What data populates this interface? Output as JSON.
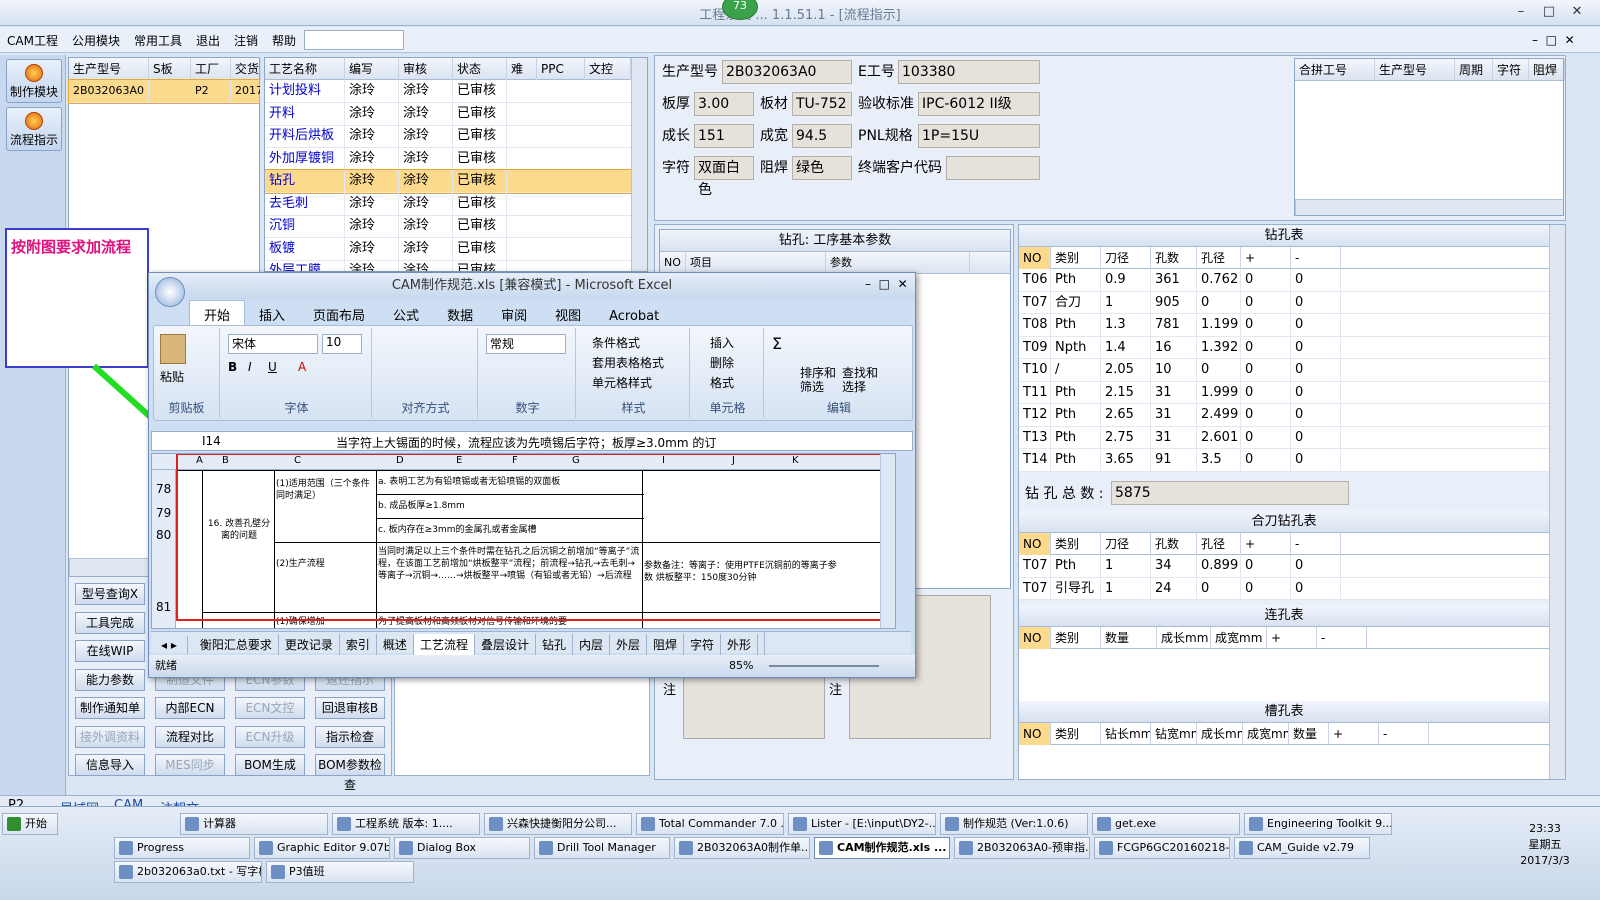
{
  "app": {
    "title": "工程系统 ...  1.1.51.1 - [流程指示]",
    "badge": "73",
    "min": "–",
    "max": "□",
    "close": "✕"
  },
  "menu": {
    "items": [
      "CAM工程",
      "公用模块",
      "常用工具",
      "退出",
      "注销",
      "帮助"
    ],
    "helpArrow": "▾",
    "innerCtrl": [
      "–",
      "□",
      "✕"
    ]
  },
  "leftbar": {
    "btn1": "制作模块",
    "btn2": "流程指示"
  },
  "orderGrid": {
    "headers": [
      "生产型号",
      "S板",
      "工厂",
      "交货"
    ],
    "row": [
      "2B032063A0",
      "",
      "P2",
      "2017"
    ]
  },
  "processGrid": {
    "headers": [
      "工艺名称",
      "编写",
      "审核",
      "状态",
      "难",
      "PPC",
      "文控"
    ],
    "rows": [
      [
        "计划投料",
        "涂玲",
        "涂玲",
        "已审核"
      ],
      [
        "开料",
        "涂玲",
        "涂玲",
        "已审核"
      ],
      [
        "开料后烘板",
        "涂玲",
        "涂玲",
        "已审核"
      ],
      [
        "外加厚镀铜",
        "涂玲",
        "涂玲",
        "已审核"
      ],
      [
        "钻孔",
        "涂玲",
        "涂玲",
        "已审核"
      ],
      [
        "去毛刺",
        "涂玲",
        "涂玲",
        "已审核"
      ],
      [
        "沉铜",
        "涂玲",
        "涂玲",
        "已审核"
      ],
      [
        "板镀",
        "涂玲",
        "涂玲",
        "已审核"
      ],
      [
        "外层工膜",
        "涂玲",
        "涂玲",
        "已审核"
      ]
    ]
  },
  "note": {
    "text": "按附图要求加流程"
  },
  "info": {
    "l_model": "生产型号",
    "model": "2B032063A0",
    "l_eno": "E工号",
    "eno": "103380",
    "l_thick": "板厚",
    "thick": "3.00",
    "l_mat": "板材",
    "mat": "TU-752",
    "l_std": "验收标准",
    "std": "IPC-6012 II级",
    "l_len": "成长",
    "len": "151",
    "l_wid": "成宽",
    "wid": "94.5",
    "l_pnl": "PNL规格",
    "pnl": "1P=15U",
    "l_char": "字符",
    "char": "双面白色",
    "l_mask": "阻焊",
    "mask": "绿色",
    "l_cust": "终端客户代码",
    "cust": ""
  },
  "mergeGrid": {
    "headers": [
      "合拼工号",
      "生产型号",
      "周期",
      "字符",
      "阻焊"
    ]
  },
  "drillParam": {
    "title": "钻孔: 工序基本参数",
    "headers": [
      "NO",
      "项目",
      "参数"
    ]
  },
  "drillTable": {
    "title": "钻孔表",
    "headers": [
      "NO",
      "类别",
      "刀径",
      "孔数",
      "孔径",
      "+",
      "-"
    ],
    "rows": [
      [
        "T06",
        "Pth",
        "0.9",
        "361",
        "0.762",
        "0",
        "0"
      ],
      [
        "T07",
        "合刀",
        "1",
        "905",
        "0",
        "0",
        "0"
      ],
      [
        "T08",
        "Pth",
        "1.3",
        "781",
        "1.199",
        "0",
        "0"
      ],
      [
        "T09",
        "Npth",
        "1.4",
        "16",
        "1.392",
        "0",
        "0"
      ],
      [
        "T10",
        "/",
        "2.05",
        "10",
        "0",
        "0",
        "0"
      ],
      [
        "T11",
        "Pth",
        "2.15",
        "31",
        "1.999",
        "0",
        "0"
      ],
      [
        "T12",
        "Pth",
        "2.65",
        "31",
        "2.499",
        "0",
        "0"
      ],
      [
        "T13",
        "Pth",
        "2.75",
        "31",
        "2.601",
        "0",
        "0"
      ],
      [
        "T14",
        "Pth",
        "3.65",
        "91",
        "3.5",
        "0",
        "0"
      ]
    ],
    "totalLabel": "钻 孔 总 数 :",
    "total": "5875"
  },
  "comboTable": {
    "title": "合刀钻孔表",
    "headers": [
      "NO",
      "类别",
      "刀径",
      "孔数",
      "孔径",
      "+",
      "-"
    ],
    "rows": [
      [
        "T07",
        "Pth",
        "1",
        "34",
        "0.899",
        "0",
        "0"
      ],
      [
        "T07",
        "引导孔",
        "1",
        "24",
        "0",
        "0",
        "0"
      ]
    ]
  },
  "slotTable": {
    "title": "连孔表",
    "headers": [
      "NO",
      "类别",
      "数量",
      "成长mm",
      "成宽mm",
      "+",
      "-"
    ]
  },
  "grooveTable": {
    "title": "槽孔表",
    "headers": [
      "NO",
      "类别",
      "钻长mm",
      "钻宽mm",
      "成长mm",
      "成宽mm",
      "数量",
      "+",
      "-"
    ]
  },
  "notes": {
    "l1": "注",
    "l2": "注"
  },
  "buttons": [
    [
      "型号查询X",
      "",
      "",
      ""
    ],
    [
      "工具完成",
      "",
      "",
      ""
    ],
    [
      "在线WIP",
      "",
      "",
      ""
    ],
    [
      "能力参数",
      "制造文件",
      "ECN参数",
      "返还指示"
    ],
    [
      "制作通知单",
      "内部ECN",
      "ECN文控",
      "回退审核B"
    ],
    [
      "接外调资料",
      "流程对比",
      "ECN升级",
      "指示检查"
    ],
    [
      "信息导入",
      "MES同步",
      "BOM生成",
      "BOM参数检查"
    ]
  ],
  "excel": {
    "title": "CAM制作规范.xls [兼容模式] - Microsoft Excel",
    "tabs": [
      "开始",
      "插入",
      "页面布局",
      "公式",
      "数据",
      "审阅",
      "视图",
      "Acrobat"
    ],
    "groups": {
      "clip": "剪贴板",
      "paste": "粘贴",
      "font": "字体",
      "fontName": "宋体",
      "fontSize": "10",
      "align": "对齐方式",
      "num": "数字",
      "numFmt": "常规",
      "style": "样式",
      "cond": "条件格式",
      "tblfmt": "套用表格格式",
      "cellfmt": "单元格样式",
      "cells": "单元格",
      "ins": "插入",
      "del": "删除",
      "fmt": "格式",
      "edit": "编辑",
      "sort": "排序和\n筛选",
      "find": "查找和\n选择"
    },
    "nameBox": "I14",
    "formula": "当字符上大锡面的时候，流程应该为先喷锡后字符；板厚≥3.0mm 的订",
    "cols": [
      "A",
      "B",
      "C",
      "D",
      "E",
      "F",
      "G",
      "I",
      "J",
      "K"
    ],
    "rowNums": [
      "78",
      "79",
      "80",
      "81"
    ],
    "cB": "16. 改善孔壁分离的问题",
    "cC1": "(1)适用范围（三个条件同时满足）",
    "cC2": "(2)生产流程",
    "cC3": "(1)确保增加",
    "d78": "a. 表明工艺为有铅喷锡或者无铅喷锡的双面板",
    "d79": "b. 成品板厚≥1.8mm",
    "d80": "c. 板内存在≥3mm的金属孔或者金属槽",
    "d81": "当同时满足以上三个条件时需在钻孔之后沉铜之前增加“等离子”流程，在该面工艺前增加“烘板整平”流程；前流程→钻孔→去毛刺→等离子→沉铜→……→烘板整平→喷锡（有铅或者无铅）→后流程",
    "i81": "参数备注：等离子：使用PTFE沉铜前的等离子参数 烘板整平：150度30分钟",
    "d82": "为了提高板材和高频板材对信号传输和环境的要",
    "sheetTabs": [
      "衡阳汇总要求",
      "更改记录",
      "索引",
      "概述",
      "工艺流程",
      "叠层设计",
      "钻孔",
      "内层",
      "外层",
      "阻焊",
      "字符",
      "外形"
    ],
    "status": "就绪",
    "zoom": "85%"
  },
  "bottom": {
    "site": "P2",
    "a": "局域网",
    "b": "CAM",
    "c": "注朝文"
  },
  "taskbar": {
    "start": "开始",
    "row1": [
      "计算器",
      "工程系统 版本: 1....",
      "兴森快捷衡阳分公司...",
      "Total Commander 7.0 ...",
      "Lister - [E:\\input\\DY2-...",
      "制作规范 (Ver:1.0.6)",
      "get.exe",
      "Engineering Toolkit 9...."
    ],
    "row2": [
      "Progress",
      "Graphic Editor 9.07b...",
      "Dialog Box",
      "Drill Tool Manager",
      "2B032063A0制作单....",
      "CAM制作规范.xls ...",
      "2B032063A0-预审指...",
      "FCGP6GC20160218-...",
      "CAM_Guide v2.79"
    ],
    "row3": [
      "2b032063a0.txt - 写字板",
      "P3值班"
    ],
    "time": "23:33",
    "weekday": "星期五",
    "date": "2017/3/3"
  }
}
